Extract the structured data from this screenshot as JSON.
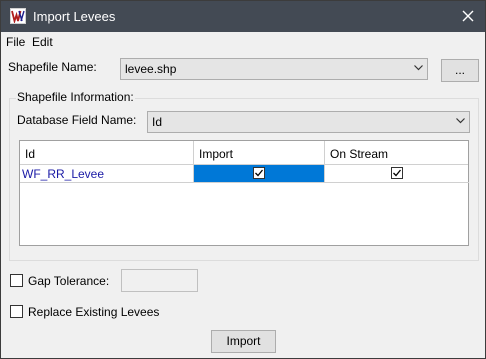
{
  "window": {
    "title": "Import Levees"
  },
  "menu": {
    "file": "File",
    "edit": "Edit"
  },
  "shapefile": {
    "label": "Shapefile Name:",
    "value": "levee.shp",
    "browse_label": "..."
  },
  "info_group": {
    "legend": "Shapefile Information:"
  },
  "db_field": {
    "label": "Database Field Name:",
    "value": "Id"
  },
  "table": {
    "columns": [
      "Id",
      "Import",
      "On Stream"
    ],
    "rows": [
      {
        "id": "WF_RR_Levee",
        "import": true,
        "on_stream": true
      }
    ]
  },
  "gap_tolerance": {
    "label": "Gap Tolerance:",
    "checked": false,
    "value": ""
  },
  "replace_existing": {
    "label": "Replace Existing Levees",
    "checked": false
  },
  "import_button": {
    "label": "Import"
  },
  "colors": {
    "titlebar": "#434a54",
    "selection": "#0078d7",
    "link_text": "#1a1aa6"
  }
}
